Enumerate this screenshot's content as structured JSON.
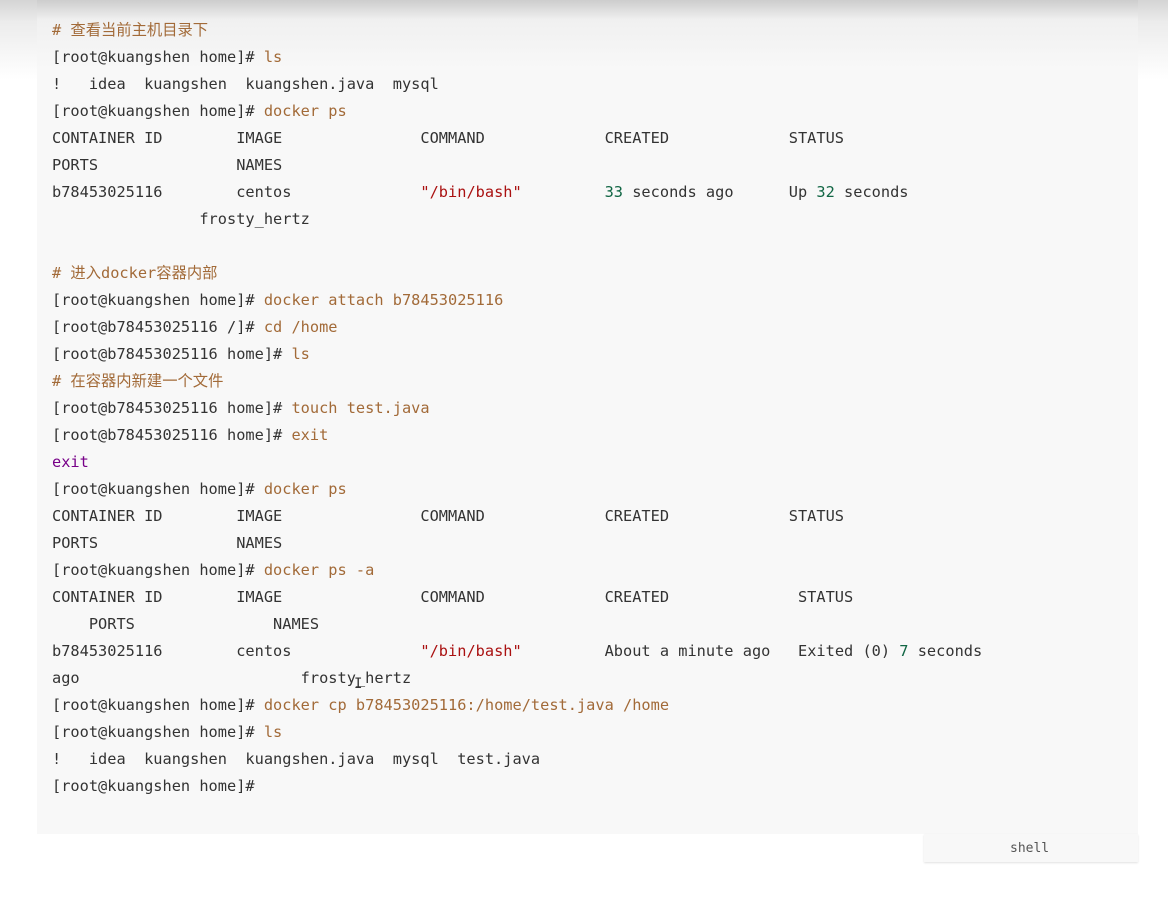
{
  "code_block": {
    "language": "shell",
    "lines": [
      [
        {
          "t": "# 查看当前主机目录下",
          "c": "comment"
        }
      ],
      [
        {
          "t": "[root@kuangshen home]# "
        },
        {
          "t": "ls",
          "c": "cmd"
        }
      ],
      [
        {
          "t": "!   idea  kuangshen  kuangshen.java  mysql"
        }
      ],
      [
        {
          "t": "[root@kuangshen home]# "
        },
        {
          "t": "docker ps",
          "c": "cmd"
        }
      ],
      [
        {
          "t": "CONTAINER ID        IMAGE               COMMAND             CREATED             STATUS"
        }
      ],
      [
        {
          "t": "PORTS               NAMES"
        }
      ],
      [
        {
          "t": "b78453025116        centos              "
        },
        {
          "t": "\"/bin/bash\"",
          "c": "str"
        },
        {
          "t": "         "
        },
        {
          "t": "33",
          "c": "num"
        },
        {
          "t": " seconds ago      Up "
        },
        {
          "t": "32",
          "c": "num"
        },
        {
          "t": " seconds"
        }
      ],
      [
        {
          "t": "                frosty_hertz"
        }
      ],
      [
        {
          "t": ""
        }
      ],
      [
        {
          "t": "# 进入docker容器内部",
          "c": "comment"
        }
      ],
      [
        {
          "t": "[root@kuangshen home]# "
        },
        {
          "t": "docker attach b78453025116",
          "c": "cmd"
        }
      ],
      [
        {
          "t": "[root@b78453025116 /]# "
        },
        {
          "t": "cd /home",
          "c": "cmd"
        }
      ],
      [
        {
          "t": "[root@b78453025116 home]# "
        },
        {
          "t": "ls",
          "c": "cmd"
        }
      ],
      [
        {
          "t": "# 在容器内新建一个文件",
          "c": "comment"
        }
      ],
      [
        {
          "t": "[root@b78453025116 home]# "
        },
        {
          "t": "touch test.java",
          "c": "cmd"
        }
      ],
      [
        {
          "t": "[root@b78453025116 home]# "
        },
        {
          "t": "exit",
          "c": "cmd"
        }
      ],
      [
        {
          "t": "exit",
          "c": "kw"
        }
      ],
      [
        {
          "t": "[root@kuangshen home]# "
        },
        {
          "t": "docker ps",
          "c": "cmd"
        }
      ],
      [
        {
          "t": "CONTAINER ID        IMAGE               COMMAND             CREATED             STATUS"
        }
      ],
      [
        {
          "t": "PORTS               NAMES"
        }
      ],
      [
        {
          "t": "[root@kuangshen home]# "
        },
        {
          "t": "docker ps -a",
          "c": "cmd"
        }
      ],
      [
        {
          "t": "CONTAINER ID        IMAGE               COMMAND             CREATED              STATUS"
        }
      ],
      [
        {
          "t": "    PORTS               NAMES"
        }
      ],
      [
        {
          "t": "b78453025116        centos              "
        },
        {
          "t": "\"/bin/bash\"",
          "c": "str"
        },
        {
          "t": "         About a minute ago   Exited (0) "
        },
        {
          "t": "7",
          "c": "num"
        },
        {
          "t": " seconds"
        }
      ],
      [
        {
          "t": "ago                        frosty_hertz"
        }
      ],
      [
        {
          "t": "[root@kuangshen home]# "
        },
        {
          "t": "docker cp b78453025116:/home/test.java /home",
          "c": "cmd"
        }
      ],
      [
        {
          "t": "[root@kuangshen home]# "
        },
        {
          "t": "ls",
          "c": "cmd"
        }
      ],
      [
        {
          "t": "!   idea  kuangshen  kuangshen.java  mysql  test.java"
        }
      ],
      [
        {
          "t": "[root@kuangshen home]#"
        }
      ]
    ]
  },
  "colors": {
    "background": "#f8f8f8",
    "text": "#333333",
    "comment": "#a26a38",
    "command": "#a26a38",
    "string": "#aa1111",
    "number": "#116644",
    "keyword": "#770088"
  },
  "cursor_glyph": "I"
}
